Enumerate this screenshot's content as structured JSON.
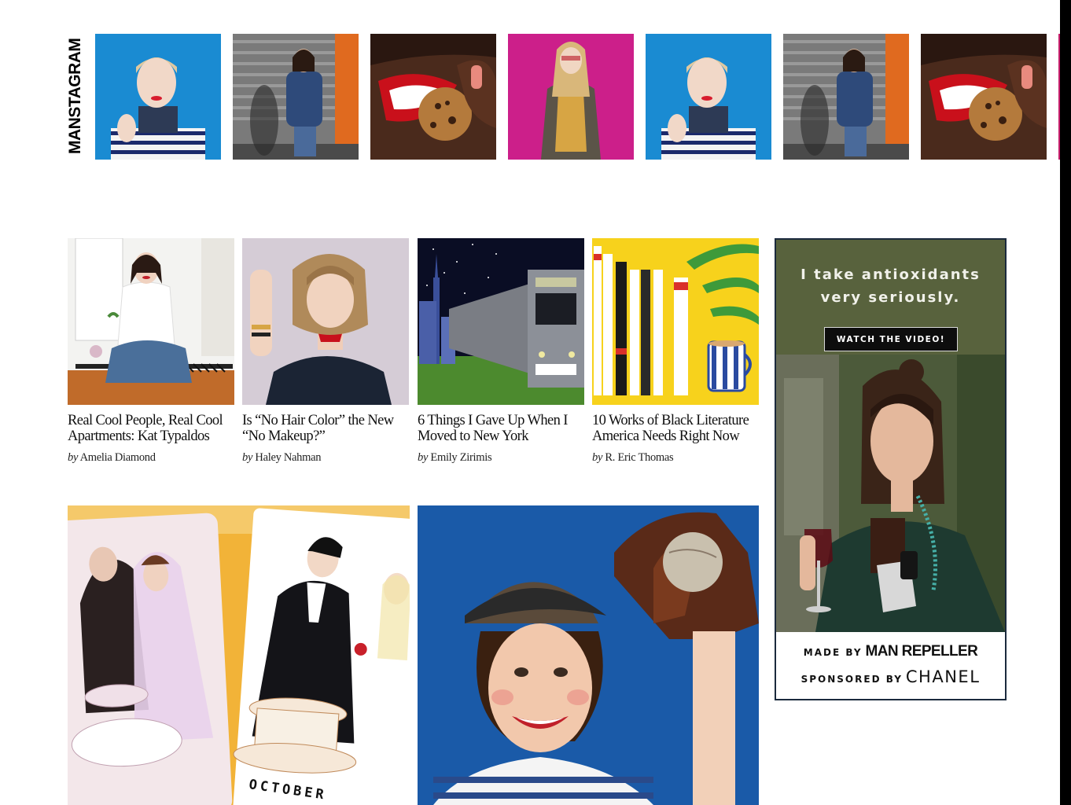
{
  "manstagram": {
    "label": "MANSTAGRAM",
    "thumbs": [
      {
        "name": "manstagram-photo-striped-shirt"
      },
      {
        "name": "manstagram-photo-denim-jacket"
      },
      {
        "name": "manstagram-photo-cookie-bite"
      },
      {
        "name": "manstagram-photo-pink-backdrop"
      },
      {
        "name": "manstagram-photo-striped-shirt"
      },
      {
        "name": "manstagram-photo-denim-jacket"
      },
      {
        "name": "manstagram-photo-cookie-bite"
      }
    ]
  },
  "articles": [
    {
      "title": "Real Cool People, Real Cool Apartments: Kat Typaldos",
      "by": "by",
      "author": "Amelia Diamond"
    },
    {
      "title": "Is “No Hair Color” the New “No Makeup?”",
      "by": "by",
      "author": "Haley Nahman"
    },
    {
      "title": "6 Things I Gave Up When I Moved to New York",
      "by": "by",
      "author": "Emily Zirimis"
    },
    {
      "title": "10 Works of Black Literature America Needs Right Now",
      "by": "by",
      "author": "R. Eric Thomas"
    }
  ],
  "features": [
    {
      "name": "feature-wedding-illustration",
      "caption_fragment": "OCTOBER"
    },
    {
      "name": "feature-baseball-girl"
    }
  ],
  "ad": {
    "headline": "I take antioxidants\nvery seriously.",
    "button": "WATCH THE VIDEO!",
    "made_by_prefix": "MADE BY",
    "made_by_brand": "MAN REPELLER",
    "sponsor_prefix": "SPONSORED BY",
    "sponsor_brand": "CHANEL"
  },
  "colors": {
    "ad_background": "#58623d",
    "ad_border": "#1b2a3d",
    "page_background": "#ffffff"
  }
}
